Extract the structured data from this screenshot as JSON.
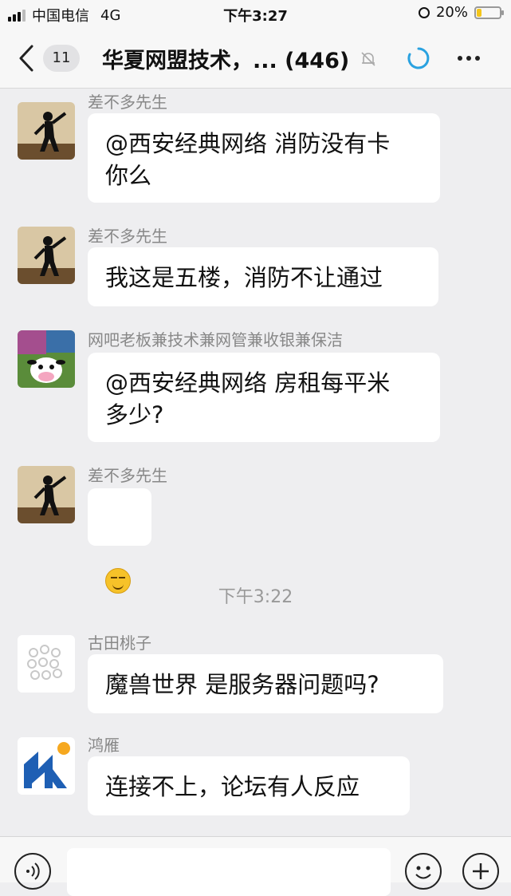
{
  "status_bar": {
    "carrier": "中国电信",
    "network": "4G",
    "time": "下午3:27",
    "battery_text": "20%",
    "battery_level": 0.2,
    "battery_color": "#f4c51a"
  },
  "header": {
    "back_icon": "chevron-left-icon",
    "unread_count": "11",
    "title": "华夏网盟技术，... (446)",
    "mute_icon": "bell-muted-icon",
    "loading_icon": "loading-spinner-icon",
    "more_icon": "more-dots-icon",
    "accent_color": "#2aa2e0"
  },
  "messages": [
    {
      "sender": "差不多先生",
      "text": "@西安经典网络 消防没有卡\n你么",
      "avatar": "silhouette-avatar"
    },
    {
      "sender": "差不多先生",
      "text": "我这是五楼，消防不让通过",
      "avatar": "silhouette-avatar"
    },
    {
      "sender": "网吧老板兼技术兼网管兼收银兼保洁",
      "text": "@西安经典网络 房租每平米\n多少?",
      "avatar": "cow-toy-avatar"
    },
    {
      "sender": "差不多先生",
      "text": "",
      "emoji": "smirk-emoji",
      "avatar": "silhouette-avatar"
    },
    {
      "sender": "古田桃子",
      "text": "魔兽世界 是服务器问题吗?",
      "avatar": "pattern-avatar"
    },
    {
      "sender": "鸿雁",
      "text": "连接不上，论坛有人反应",
      "avatar": "blue-logo-avatar"
    }
  ],
  "time_divider": "下午3:22",
  "input_bar": {
    "voice_icon": "voice-icon",
    "emoji_icon": "emoji-icon",
    "plus_icon": "plus-icon"
  }
}
